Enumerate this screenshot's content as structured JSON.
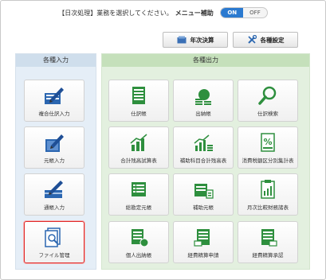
{
  "topbar": {
    "message": "【日次処理】業務を選択してください。",
    "menu_assist_label": "メニュー補助",
    "toggle_on": "ON",
    "toggle_off": "OFF"
  },
  "actions": {
    "annual_close": "年次決算",
    "settings": "各種設定"
  },
  "input_panel": {
    "title": "各種入力",
    "items": [
      "複合仕訳入力",
      "元帳入力",
      "通帳入力",
      "ファイル管理"
    ]
  },
  "output_panel": {
    "title": "各種出力",
    "items": [
      "仕訳帳",
      "出納帳",
      "仕訳検索",
      "合計残高試算表",
      "補助科目合計残高表",
      "消費税額区分別集計表",
      "総勘定元帳",
      "補助元帳",
      "月次比較財務諸表",
      "個人出納帳",
      "経費精算申請",
      "経費精算承認"
    ]
  },
  "colors": {
    "accent_blue": "#2b7ad0",
    "icon_green": "#2e8f3e",
    "selected_border": "#e02828"
  }
}
